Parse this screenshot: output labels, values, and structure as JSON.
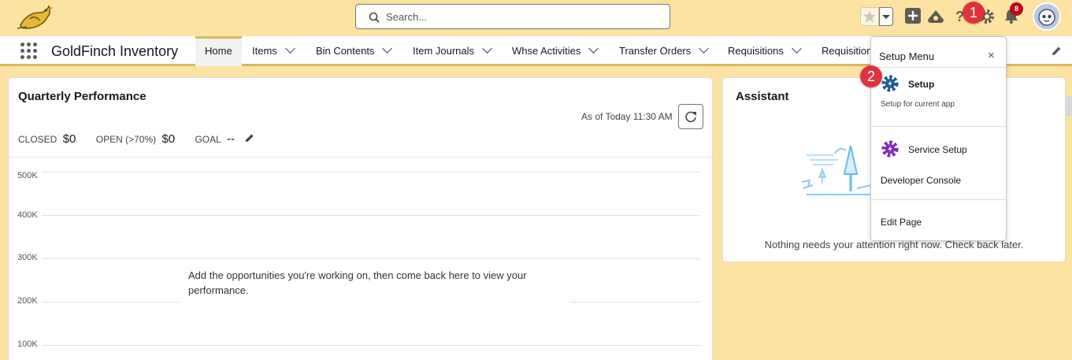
{
  "header": {
    "search_placeholder": "Search...",
    "notification_count": "8",
    "steps": [
      "1",
      "2"
    ]
  },
  "nav": {
    "app_name": "GoldFinch Inventory",
    "items": [
      {
        "label": "Home",
        "active": true
      },
      {
        "label": "Items"
      },
      {
        "label": "Bin Contents"
      },
      {
        "label": "Item Journals"
      },
      {
        "label": "Whse Activities"
      },
      {
        "label": "Transfer Orders"
      },
      {
        "label": "Requisitions"
      },
      {
        "label": "Requisition"
      }
    ]
  },
  "quarterly": {
    "title": "Quarterly Performance",
    "as_of": "As of Today 11:30 AM",
    "closed_label": "CLOSED",
    "closed_value": "$0",
    "open_label": "OPEN (>70%)",
    "open_value": "$0",
    "goal_label": "GOAL",
    "goal_value": "--",
    "y_ticks": [
      "500K",
      "400K",
      "300K",
      "200K",
      "100K"
    ],
    "empty_message": "Add the opportunities you're working on, then come back here to view your performance."
  },
  "assistant": {
    "title": "Assistant",
    "empty_message": "Nothing needs your attention right now. Check back later."
  },
  "setup_menu": {
    "title": "Setup Menu",
    "close": "×",
    "setup_label": "Setup",
    "setup_sub": "Setup for current app",
    "service_setup": "Service Setup",
    "developer_console": "Developer Console",
    "edit_page": "Edit Page"
  },
  "colors": {
    "header_bg": "#fce3a1",
    "nav_accent": "#d9b660",
    "badge_red": "#ba0517",
    "step_red": "#e0323c",
    "setup_blue": "#1b5d8f",
    "service_purple": "#7b2bb8"
  }
}
